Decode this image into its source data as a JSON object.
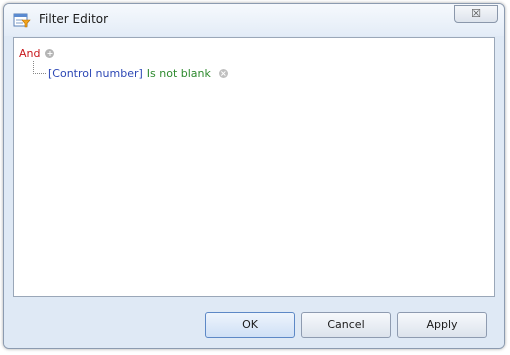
{
  "window": {
    "title": "Filter Editor",
    "close_glyph": "☒"
  },
  "tree": {
    "root": {
      "operator": "And",
      "add_icon": "add-circle-icon"
    },
    "conditions": [
      {
        "field": "[Control number]",
        "operation": "Is not blank",
        "remove_icon": "remove-circle-icon"
      }
    ]
  },
  "buttons": {
    "ok": "OK",
    "cancel": "Cancel",
    "apply": "Apply"
  },
  "colors": {
    "operator": "#c8191d",
    "field": "#2d48b5",
    "operation": "#2e8a2e"
  }
}
